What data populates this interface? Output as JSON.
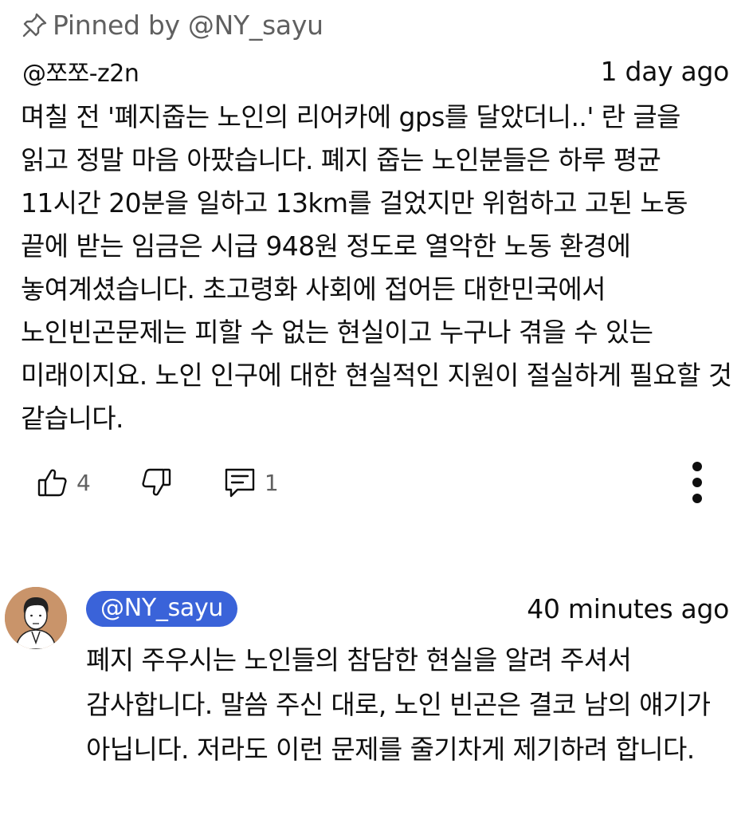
{
  "pinned": {
    "label": "Pinned by @NY_sayu",
    "icon": "pin-icon"
  },
  "comment": {
    "author": "@쪼쪼-z2n",
    "time": "1 day ago",
    "text": "며칠 전 '폐지줍는 노인의 리어카에 gps를 달았더니..' 란 글을 읽고 정말 마음 아팠습니다. 폐지 줍는 노인분들은 하루 평균 11시간 20분을 일하고 13km를 걸었지만 위험하고 고된 노동 끝에 받는 임금은 시급 948원 정도로 열악한 노동 환경에 놓여계셨습니다. 초고령화 사회에 접어든 대한민국에서 노인빈곤문제는 피할 수 없는 현실이고 누구나 겪을 수 있는 미래이지요. 노인 인구에 대한 현실적인 지원이 절실하게 필요할 것 같습니다.",
    "actions": {
      "like_icon": "thumbs-up-icon",
      "like_count": "4",
      "dislike_icon": "thumbs-down-icon",
      "reply_icon": "comment-icon",
      "reply_count": "1",
      "more_icon": "more-vertical-icon"
    }
  },
  "reply": {
    "avatar": "avatar",
    "handle": "@NY_sayu",
    "time": "40 minutes ago",
    "text": "폐지 주우시는 노인들의 참담한 현실을 알려 주셔서 감사합니다. 말씀 주신 대로, 노인 빈곤은 결코 남의 얘기가 아닙니다. 저라도 이런 문제를 줄기차게 제기하려 합니다."
  },
  "colors": {
    "handle_chip": "#3a63d9",
    "secondary_text": "#606060",
    "primary_text": "#0f0f0f",
    "avatar_bg": "#c9946a"
  }
}
